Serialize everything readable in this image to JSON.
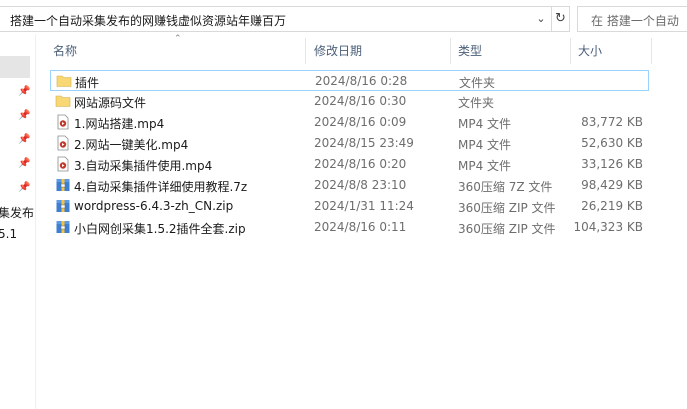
{
  "address": {
    "path": "搭建一个自动采集发布的网赚钱虚似资源站年赚百万",
    "search_placeholder": "在 搭建一个自动"
  },
  "nav": {
    "partial_label_1": "集发布",
    "partial_label_2": "5.1"
  },
  "columns": {
    "name": "名称",
    "date": "修改日期",
    "type": "类型",
    "size": "大小"
  },
  "files": [
    {
      "name": "插件",
      "date": "2024/8/16 0:28",
      "type": "文件夹",
      "size": "",
      "icon": "folder-icon"
    },
    {
      "name": "网站源码文件",
      "date": "2024/8/16 0:30",
      "type": "文件夹",
      "size": "",
      "icon": "folder-icon"
    },
    {
      "name": "1.网站搭建.mp4",
      "date": "2024/8/16 0:09",
      "type": "MP4 文件",
      "size": "83,772 KB",
      "icon": "video-file-icon"
    },
    {
      "name": "2.网站一键美化.mp4",
      "date": "2024/8/15 23:49",
      "type": "MP4 文件",
      "size": "52,630 KB",
      "icon": "video-file-icon"
    },
    {
      "name": "3.自动采集插件使用.mp4",
      "date": "2024/8/16 0:20",
      "type": "MP4 文件",
      "size": "33,126 KB",
      "icon": "video-file-icon"
    },
    {
      "name": "4.自动采集插件详细使用教程.7z",
      "date": "2024/8/8 23:10",
      "type": "360压缩 7Z 文件",
      "size": "98,429 KB",
      "icon": "archive-icon"
    },
    {
      "name": "wordpress-6.4.3-zh_CN.zip",
      "date": "2024/1/31 11:24",
      "type": "360压缩 ZIP 文件",
      "size": "26,219 KB",
      "icon": "archive-icon"
    },
    {
      "name": "小白网创采集1.5.2插件全套.zip",
      "date": "2024/8/16 0:11",
      "type": "360压缩 ZIP 文件",
      "size": "104,323 KB",
      "icon": "archive-icon"
    }
  ],
  "colors": {
    "header_text": "#4c607a",
    "selection_border": "#99d1ff",
    "folder": "#f8d775"
  }
}
